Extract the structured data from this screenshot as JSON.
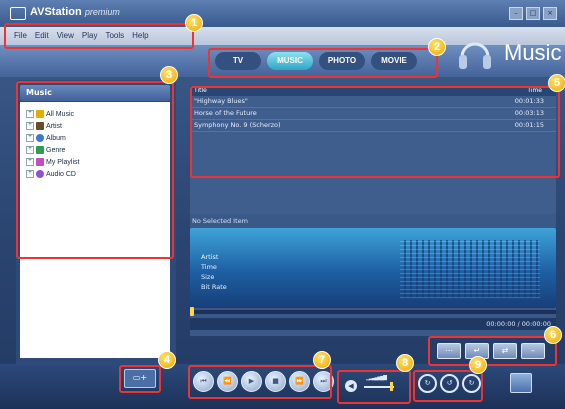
{
  "window": {
    "app_name": "AVStation",
    "app_edition": "premium",
    "controls": [
      "–",
      "□",
      "×"
    ]
  },
  "menu": [
    "File",
    "Edit",
    "View",
    "Play",
    "Tools",
    "Help"
  ],
  "header": {
    "section_title": "Music"
  },
  "tabs": [
    {
      "label": "TV"
    },
    {
      "label": "MUSIC",
      "active": true
    },
    {
      "label": "PHOTO"
    },
    {
      "label": "MOVIE"
    }
  ],
  "left_panel": {
    "title": "Music",
    "tree": [
      {
        "label": "All Music",
        "icon": "music-note-icon",
        "color": "#e0b000"
      },
      {
        "label": "Artist",
        "icon": "artist-icon",
        "color": "#6b4a2c"
      },
      {
        "label": "Album",
        "icon": "album-icon",
        "color": "#3a7ad0"
      },
      {
        "label": "Genre",
        "icon": "genre-icon",
        "color": "#2aa050"
      },
      {
        "label": "My Playlist",
        "icon": "playlist-icon",
        "color": "#c050c0"
      },
      {
        "label": "Audio CD",
        "icon": "audio-cd-icon",
        "color": "#9050d0"
      }
    ],
    "add_playlist_icon": "add-playlist-icon"
  },
  "track_list": {
    "columns": {
      "title": "Title",
      "time": "Time"
    },
    "rows": [
      {
        "title": "\"Highway Blues\"",
        "time": "00:01:33"
      },
      {
        "title": "Horse of the Future",
        "time": "00:03:13"
      },
      {
        "title": "Symphony No. 9 (Scherzo)",
        "time": "00:01:15"
      }
    ]
  },
  "now_playing": {
    "status": "No Selected Item",
    "fields": [
      "Artist",
      "Time",
      "Size",
      "Bit Rate"
    ],
    "position_text": "00:00:00 / 00:00:00",
    "progress": 0
  },
  "small_buttons": [
    "list-view-icon",
    "return-icon",
    "shuffle-icon",
    "minus-icon"
  ],
  "playback_buttons": [
    "previous-icon",
    "rewind-icon",
    "play-icon",
    "stop-icon",
    "fast-forward-icon",
    "next-icon"
  ],
  "volume_level": 0.9,
  "repeat_buttons": [
    "repeat-one-icon",
    "repeat-all-icon",
    "repeat-ab-icon"
  ],
  "callouts": [
    "1",
    "2",
    "3",
    "4",
    "5",
    "6",
    "7",
    "8",
    "9"
  ],
  "colors": {
    "highlight": "#ee3333",
    "badge": "#f0a600",
    "accent": "#2ea6c6"
  }
}
